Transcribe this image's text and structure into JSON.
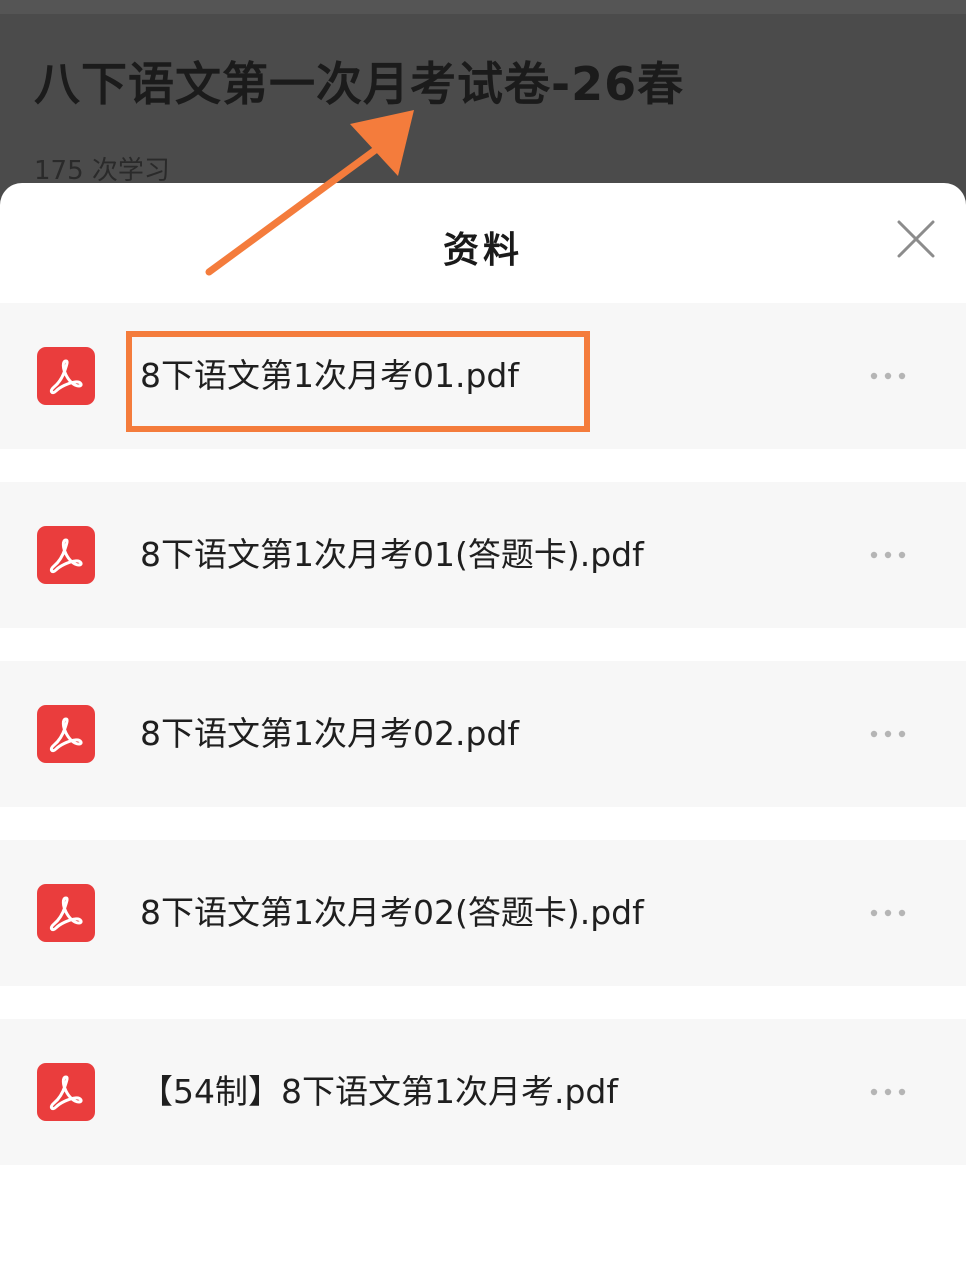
{
  "page": {
    "title": "八下语文第一次月考试卷-26春",
    "meta": "175 次学习"
  },
  "sheet": {
    "title": "资料",
    "close_icon": "close-icon"
  },
  "files": [
    {
      "name": "8下语文第1次月考01.pdf",
      "icon": "pdf-icon"
    },
    {
      "name": "8下语文第1次月考01(答题卡).pdf",
      "icon": "pdf-icon"
    },
    {
      "name": "8下语文第1次月考02.pdf",
      "icon": "pdf-icon"
    },
    {
      "name": "8下语文第1次月考02(答题卡).pdf",
      "icon": "pdf-icon"
    },
    {
      "name": "【54制】8下语文第1次月考.pdf",
      "icon": "pdf-icon"
    }
  ],
  "colors": {
    "pdf_red": "#ea3d3d",
    "annotation_orange": "#f47c3c",
    "backdrop": "#4b4b4b"
  }
}
